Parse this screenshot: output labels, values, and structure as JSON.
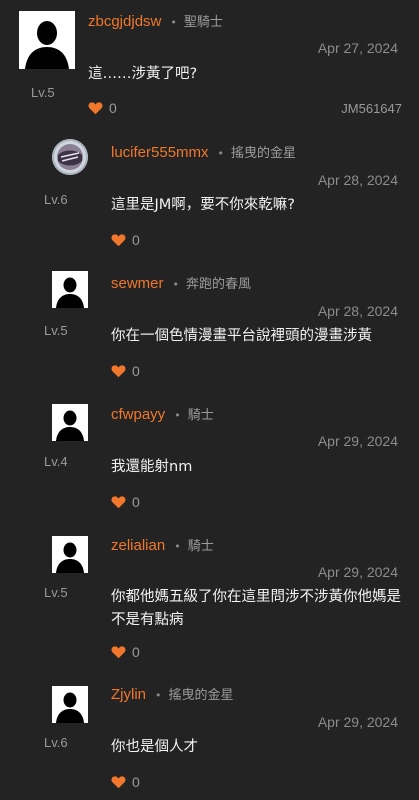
{
  "colors": {
    "background": "#232323",
    "username": "#f0772b",
    "heart": "#f0772b",
    "muted": "#9a9a9a",
    "text": "#f2f2f2"
  },
  "comments": [
    {
      "username": "zbcgjdjdsw",
      "title": "聖騎士",
      "level": "Lv.5",
      "date": "Apr 27, 2024",
      "text": "這……涉黃了吧?",
      "likes": "0",
      "tag": "JM561647",
      "avatar": "default-person-icon"
    },
    {
      "username": "lucifer555mmx",
      "title": "搖曳的金星",
      "level": "Lv.6",
      "date": "Apr 28, 2024",
      "text": "這里是JM啊，要不你來乾嘛?",
      "likes": "0",
      "avatar": "custom-image-avatar"
    },
    {
      "username": "sewmer",
      "title": "奔跑的春風",
      "level": "Lv.5",
      "date": "Apr 28, 2024",
      "text": "你在一個色情漫畫平台說裡頭的漫畫涉黃",
      "likes": "0",
      "avatar": "default-person-icon"
    },
    {
      "username": "cfwpayy",
      "title": "騎士",
      "level": "Lv.4",
      "date": "Apr 29, 2024",
      "text": "我還能射nm",
      "likes": "0",
      "avatar": "default-person-icon"
    },
    {
      "username": "zelialian",
      "title": "騎士",
      "level": "Lv.5",
      "date": "Apr 29, 2024",
      "text": "你都他媽五級了你在這里問涉不涉黃你他媽是不是有點病",
      "likes": "0",
      "avatar": "default-person-icon"
    },
    {
      "username": "Zjylin",
      "title": "搖曳的金星",
      "level": "Lv.6",
      "date": "Apr 29, 2024",
      "text": "你也是個人才",
      "likes": "0",
      "avatar": "default-person-icon"
    }
  ]
}
